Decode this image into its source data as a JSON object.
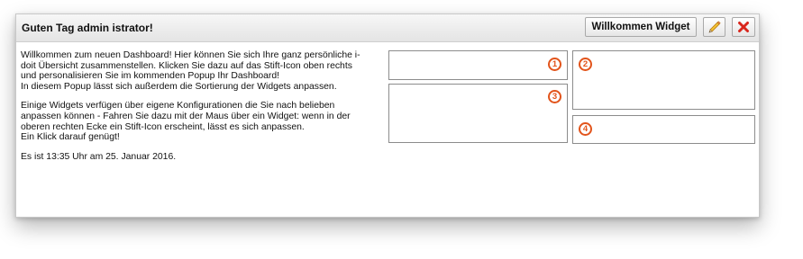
{
  "header": {
    "title": "Guten Tag admin istrator!",
    "welcome_button": "Willkommen Widget",
    "edit_icon": "pencil-icon",
    "close_icon": "close-x-icon"
  },
  "content": {
    "para1_line1": "Willkommen zum neuen Dashboard! Hier können Sie sich Ihre ganz persönliche i-",
    "para1_line2": "doit Übersicht zusammenstellen. Klicken Sie dazu auf das Stift-Icon oben rechts",
    "para1_line3": "und personalisieren Sie im kommenden Popup Ihr Dashboard!",
    "para1_line4": "In diesem Popup lässt sich außerdem die Sortierung der Widgets anpassen.",
    "para2_line1": "Einige Widgets verfügen über eigene Konfigurationen die Sie nach belieben",
    "para2_line2": "anpassen können - Fahren Sie dazu mit der Maus über ein Widget: wenn in der",
    "para2_line3": "oberen rechten Ecke ein Stift-Icon erscheint, lässt es sich anpassen.",
    "para2_line4": "Ein Klick darauf genügt!",
    "time_line": "Es ist 13:35 Uhr am 25. Januar 2016."
  },
  "slots": [
    {
      "label": "1"
    },
    {
      "label": "2"
    },
    {
      "label": "3"
    },
    {
      "label": "4"
    }
  ],
  "colors": {
    "badge": "#e2541b",
    "close_icon": "#d9261c",
    "edit_icon": "#e5a21a"
  }
}
